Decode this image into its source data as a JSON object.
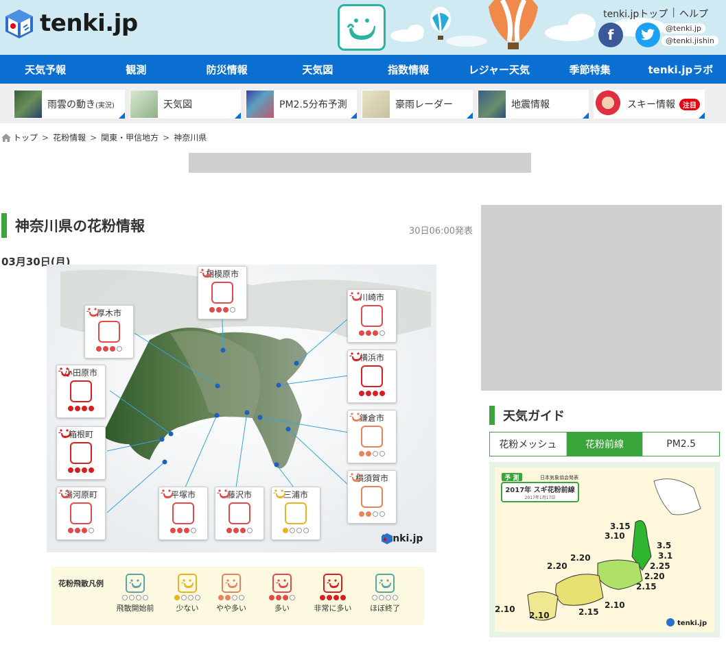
{
  "header": {
    "logo_text": "tenki.jp",
    "links": [
      "tenki.jpトップ",
      "ヘルプ"
    ],
    "sns": {
      "fb": "f",
      "handles": [
        "@tenki.jp",
        "@tenki.jishin"
      ]
    }
  },
  "nav": [
    "天気予報",
    "観測",
    "防災情報",
    "天気図",
    "指数情報",
    "レジャー天気",
    "季節特集",
    "tenki.jpラボ"
  ],
  "quick_links": [
    {
      "label": "雨雲の動き",
      "small": "(実況)"
    },
    {
      "label": "天気図",
      "small": ""
    },
    {
      "label": "PM2.5分布予測",
      "small": ""
    },
    {
      "label": "豪雨レーダー",
      "small": ""
    },
    {
      "label": "地震情報",
      "small": ""
    },
    {
      "label": "スキー情報",
      "small": "",
      "badge": "注目"
    }
  ],
  "breadcrumb": [
    "トップ",
    "花粉情報",
    "関東・甲信地方",
    "神奈川県"
  ],
  "section": {
    "title": "神奈川県の花粉情報",
    "issued": "30日06:00発表",
    "date": "03月30日(月)"
  },
  "levels": {
    "start": {
      "color": "#5aa6a6",
      "filled": 0,
      "label": "飛散開始前"
    },
    "low": {
      "color": "#e6b422",
      "filled": 1,
      "label": "少ない"
    },
    "mid": {
      "color": "#e8825a",
      "filled": 2,
      "label": "やや多い"
    },
    "high": {
      "color": "#e04a4a",
      "filled": 3,
      "label": "多い"
    },
    "vhigh": {
      "color": "#d81e1e",
      "filled": 4,
      "label": "非常に多い"
    },
    "end": {
      "color": "#5aa6a6",
      "filled": 0,
      "label": "ほぼ終了"
    }
  },
  "cities": [
    {
      "name": "相模原市",
      "level": "high"
    },
    {
      "name": "川崎市",
      "level": "high"
    },
    {
      "name": "厚木市",
      "level": "high"
    },
    {
      "name": "横浜市",
      "level": "vhigh"
    },
    {
      "name": "小田原市",
      "level": "vhigh"
    },
    {
      "name": "鎌倉市",
      "level": "mid"
    },
    {
      "name": "箱根町",
      "level": "vhigh"
    },
    {
      "name": "横須賀市",
      "level": "mid"
    },
    {
      "name": "湯河原町",
      "level": "high"
    },
    {
      "name": "平塚市",
      "level": "high"
    },
    {
      "name": "藤沢市",
      "level": "high"
    },
    {
      "name": "三浦市",
      "level": "low"
    }
  ],
  "legend": {
    "title": "花粉飛散凡例",
    "order": [
      "start",
      "low",
      "mid",
      "high",
      "vhigh",
      "end"
    ]
  },
  "map_logo": "tenki.jp",
  "guide": {
    "title": "天気ガイド",
    "tabs": [
      "花粉メッシュ",
      "花粉前線",
      "PM2.5"
    ],
    "active_tab": 1,
    "front": {
      "badge": "予 測",
      "publisher": "日本気象協会発表",
      "title": "2017年 スギ花粉前線",
      "date": "2017年1月17日",
      "labels": [
        "3.15",
        "3.10",
        "3.5",
        "3.1",
        "2.25",
        "2.20",
        "2.15",
        "2.20",
        "2.20",
        "2.10",
        "2.10",
        "2.15",
        "2.10"
      ],
      "logo": "tenki.jp"
    }
  },
  "colors": {
    "nav": "#0b6fd1",
    "accent": "#3aa53a",
    "header_bg": "#cfeaf3"
  }
}
